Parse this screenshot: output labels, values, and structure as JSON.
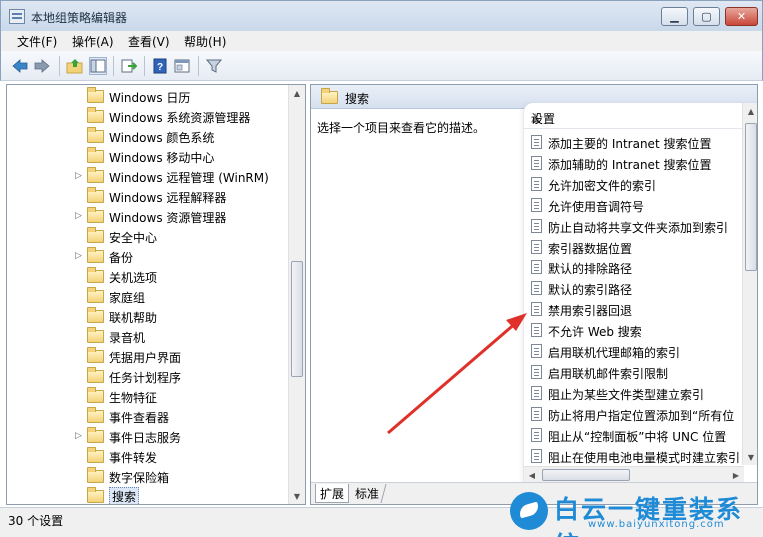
{
  "window": {
    "title": "本地组策略编辑器",
    "min": "▁",
    "max": "▢",
    "close": "✕"
  },
  "menu": [
    "文件(F)",
    "操作(A)",
    "查看(V)",
    "帮助(H)"
  ],
  "toolbar_icons": [
    "back-arrow-icon",
    "forward-arrow-icon",
    "up-folder-icon",
    "show-hide-tree-icon",
    "export-icon",
    "help-icon",
    "properties-icon",
    "filter-icon"
  ],
  "tree": {
    "items": [
      {
        "label": "Windows 日历",
        "expandable": false
      },
      {
        "label": "Windows 系统资源管理器",
        "expandable": false
      },
      {
        "label": "Windows 颜色系统",
        "expandable": false
      },
      {
        "label": "Windows 移动中心",
        "expandable": false
      },
      {
        "label": "Windows 远程管理 (WinRM)",
        "expandable": true
      },
      {
        "label": "Windows 远程解释器",
        "expandable": false
      },
      {
        "label": "Windows 资源管理器",
        "expandable": true
      },
      {
        "label": "安全中心",
        "expandable": false
      },
      {
        "label": "备份",
        "expandable": true
      },
      {
        "label": "关机选项",
        "expandable": false
      },
      {
        "label": "家庭组",
        "expandable": false
      },
      {
        "label": "联机帮助",
        "expandable": false
      },
      {
        "label": "录音机",
        "expandable": false
      },
      {
        "label": "凭据用户界面",
        "expandable": false
      },
      {
        "label": "任务计划程序",
        "expandable": false
      },
      {
        "label": "生物特征",
        "expandable": false
      },
      {
        "label": "事件查看器",
        "expandable": false
      },
      {
        "label": "事件日志服务",
        "expandable": true
      },
      {
        "label": "事件转发",
        "expandable": false
      },
      {
        "label": "数字保险箱",
        "expandable": false
      },
      {
        "label": "搜索",
        "expandable": false,
        "selected": true
      }
    ]
  },
  "right": {
    "header": "搜索",
    "description": "选择一个项目来查看它的描述。",
    "column": "设置",
    "settings": [
      "添加主要的 Intranet 搜索位置",
      "添加辅助的 Intranet 搜索位置",
      "允许加密文件的索引",
      "允许使用音调符号",
      "防止自动将共享文件夹添加到索引",
      "索引器数据位置",
      "默认的排除路径",
      "默认的索引路径",
      "禁用索引器回退",
      "不允许 Web 搜索",
      "启用联机代理邮箱的索引",
      "启用联机邮件索引限制",
      "阻止为某些文件类型建立索引",
      "防止将用户指定位置添加到“所有位",
      "阻止从“控制面板”中将 UNC 位置",
      "阻止在使用电池电量模式时建立索引"
    ],
    "tabs": [
      "扩展",
      "标准"
    ]
  },
  "status": "30 个设置",
  "watermark": {
    "brand": "白云一键重装系统",
    "url": "www.baiyunxitong.com"
  },
  "colors": {
    "annotation_arrow": "#e0302a",
    "watermark": "#1f8ad6"
  }
}
